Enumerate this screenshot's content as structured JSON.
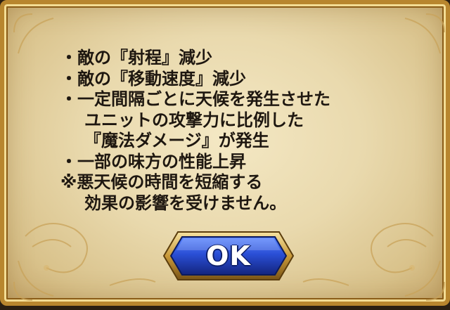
{
  "dialog": {
    "lines": [
      "・敵の『射程』減少",
      "・敵の『移動速度』減少",
      "・一定間隔ごとに天候を発生させた",
      "ユニットの攻撃力に比例した",
      "『魔法ダメージ』が発生",
      "・一部の味方の性能上昇",
      "※悪天候の時間を短縮する",
      "効果の影響を受けません。"
    ]
  },
  "ok_button": {
    "label": "OK"
  },
  "colors": {
    "parchment": "#efe1b8",
    "frame_gold": "#b8862e",
    "text": "#1e1710",
    "button_blue": "#2446c9"
  }
}
